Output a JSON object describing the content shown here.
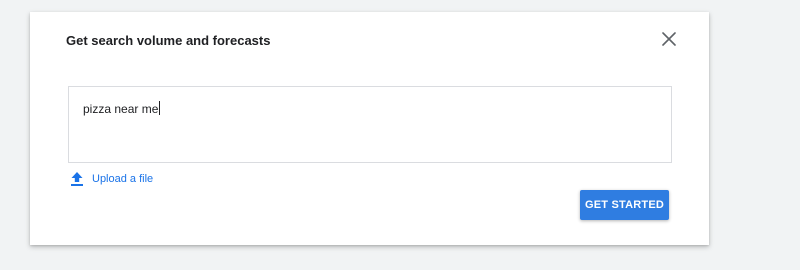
{
  "dialog": {
    "title": "Get search volume and forecasts",
    "close_icon": "close-icon",
    "input": {
      "value": "pizza near me"
    },
    "upload": {
      "icon": "upload-icon",
      "label": "Upload a file"
    },
    "primary_button": {
      "label": "GET STARTED"
    }
  },
  "colors": {
    "accent": "#1a73e8",
    "button": "#2f7de1",
    "background": "#f1f3f4",
    "icon_gray": "#5f6368"
  }
}
